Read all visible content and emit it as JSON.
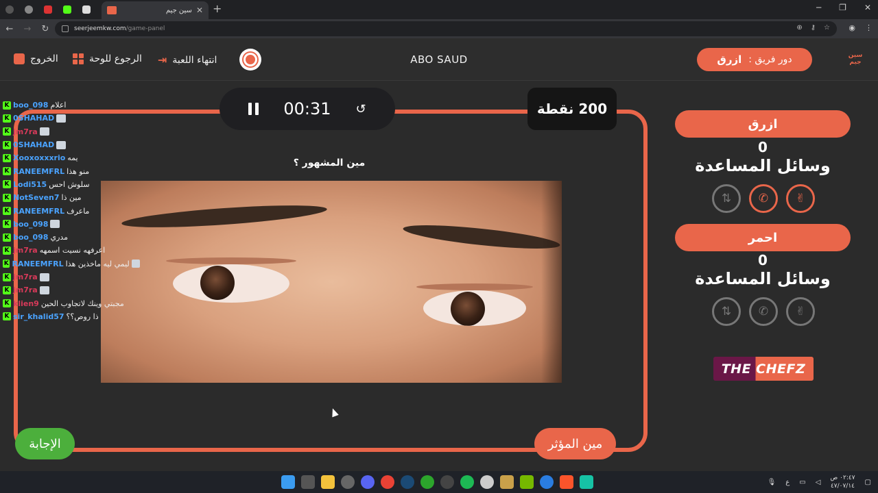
{
  "browser": {
    "tab_title": "سين جيم",
    "url_host": "seerjeemkw.com",
    "url_path": "/game-panel"
  },
  "header": {
    "exit_label": "الخروج",
    "back_to_board_label": "الرجوع للوحة",
    "end_game_label": "انتهاء اللعبة",
    "host_name": "ABO SAUD",
    "turn_label": "دور فريق :",
    "turn_team": "ازرق",
    "logo_text": "سين جيم"
  },
  "chat": [
    {
      "user": "boo_098",
      "message": "اعلام",
      "user_color": "#4aa3ff",
      "emote": false
    },
    {
      "user": "0SHAHAD",
      "message": "",
      "user_color": "#4aa3ff",
      "emote": true
    },
    {
      "user": "jm7ra",
      "message": "",
      "user_color": "#d93a5a",
      "emote": true
    },
    {
      "user": "0SHAHAD",
      "message": "",
      "user_color": "#4aa3ff",
      "emote": true
    },
    {
      "user": "Xooxoxxxrio",
      "message": "يمه",
      "user_color": "#4aa3ff",
      "emote": false
    },
    {
      "user": "RANEEMFRL",
      "message": "منو هذا",
      "user_color": "#4aa3ff",
      "emote": false
    },
    {
      "user": "Lodi515",
      "message": "سلوش احس",
      "user_color": "#4aa3ff",
      "emote": false
    },
    {
      "user": "NotSeven7",
      "message": "مين ذا",
      "user_color": "#4aa3ff",
      "emote": false
    },
    {
      "user": "RANEEMFRL",
      "message": "ماعرف",
      "user_color": "#4aa3ff",
      "emote": false
    },
    {
      "user": "boo_098",
      "message": "",
      "user_color": "#4aa3ff",
      "emote": true
    },
    {
      "user": "boo_098",
      "message": "مدري",
      "user_color": "#4aa3ff",
      "emote": false
    },
    {
      "user": "jm7ra",
      "message": "اعرفهه نسيت اسمهه",
      "user_color": "#d93a5a",
      "emote": false
    },
    {
      "user": "RANEEMFRL",
      "message": "ليمي ليه ماخذين هذا",
      "user_color": "#4aa3ff",
      "emote": true
    },
    {
      "user": "jm7ra",
      "message": "",
      "user_color": "#d93a5a",
      "emote": true
    },
    {
      "user": "jm7ra",
      "message": "",
      "user_color": "#d93a5a",
      "emote": true
    },
    {
      "user": "klien9",
      "message": "مجبتي وينك لاتجاوب الحين",
      "user_color": "#d93a5a",
      "emote": false
    },
    {
      "user": "sir_khalid57",
      "message": "ذا روص؟؟",
      "user_color": "#4aa3ff",
      "emote": false
    }
  ],
  "game": {
    "timer": "00:31",
    "points": "200 نقطة",
    "question": "مين المشهور ؟",
    "answer_label": "الإجابة",
    "category_label": "مين المؤثر"
  },
  "teams": [
    {
      "name": "ازرق",
      "score": "0",
      "aids_label": "وسائل المساعدة",
      "lifelines": [
        {
          "icon": "swap-icon",
          "active": false
        },
        {
          "icon": "phone-icon",
          "active": true
        },
        {
          "icon": "peace-hand-icon",
          "active": true
        }
      ]
    },
    {
      "name": "احمر",
      "score": "0",
      "aids_label": "وسائل المساعدة",
      "lifelines": [
        {
          "icon": "swap-icon",
          "active": false
        },
        {
          "icon": "phone-icon",
          "active": false
        },
        {
          "icon": "peace-hand-icon",
          "active": false
        }
      ]
    }
  ],
  "sponsor": "THE CHEFZ",
  "taskbar": {
    "lang": "ع",
    "time": "٠٢:٤٧ ص",
    "date": "٤٧/٠٧/١٤"
  },
  "colors": {
    "accent": "#e9664a",
    "background": "#2b2b2b",
    "answer_green": "#4caf3c",
    "kick_green": "#53fc18"
  }
}
